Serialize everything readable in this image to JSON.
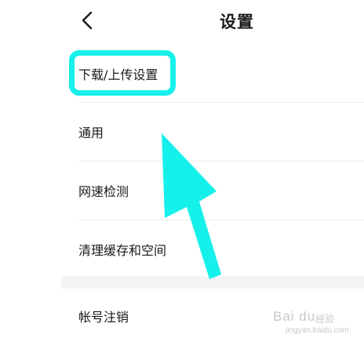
{
  "header": {
    "title": "设置",
    "back_icon": "chevron-left-icon"
  },
  "menu": {
    "items": [
      {
        "label": "下载/上传设置"
      },
      {
        "label": "通用"
      },
      {
        "label": "网速检测"
      },
      {
        "label": "清理缓存和空间"
      },
      {
        "label": "帐号注销"
      }
    ]
  },
  "annotation": {
    "highlight_color": "#16f0ea",
    "arrow_color": "#16f0ea"
  },
  "watermark": {
    "brand": "Bai du",
    "sub": "经验",
    "url": "jingyan.baidu.com"
  }
}
